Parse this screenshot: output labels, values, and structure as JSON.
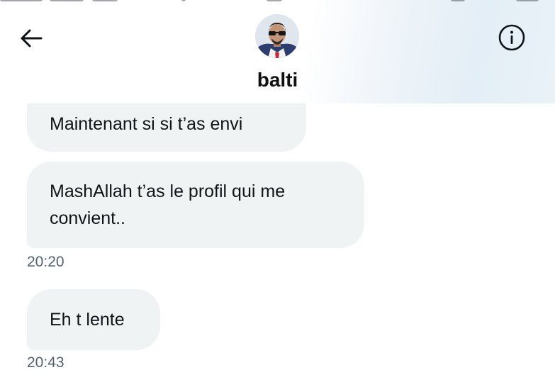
{
  "conversation": {
    "username": "balti",
    "avatar_icon": "profile-photo",
    "back_icon": "arrow-left-icon",
    "info_icon": "info-circle-icon"
  },
  "messages": [
    {
      "text": "Maintenant si si t’as envi",
      "time": ""
    },
    {
      "text": "MashAllah t’as le profil qui me convient..",
      "time": "20:20"
    },
    {
      "text": "Eh t lente",
      "time": "20:43"
    }
  ],
  "colors": {
    "bubble_bg": "#eff3f4",
    "text": "#0f1419",
    "timestamp": "#536471"
  }
}
